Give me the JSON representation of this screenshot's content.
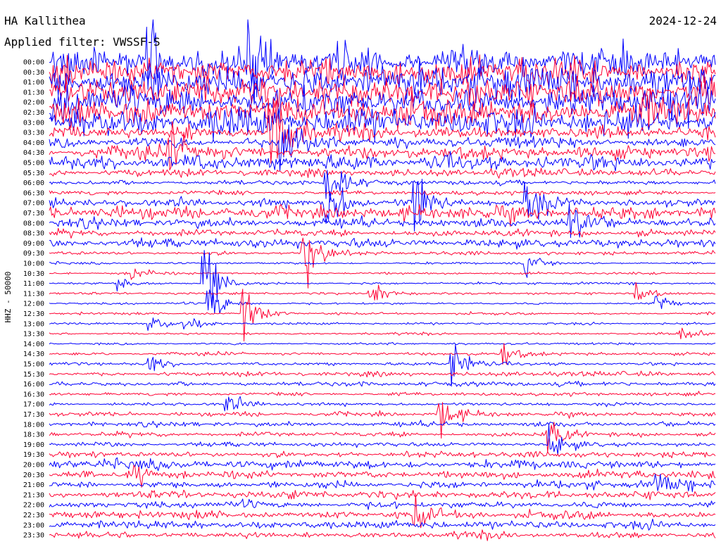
{
  "header": {
    "station": "HA Kallithea",
    "filter": "Applied filter: VWSSF-S",
    "date": "2024-12-24"
  },
  "chart_data": {
    "type": "line",
    "title": "HA Kallithea",
    "subtitle": "Applied filter: VWSSF-S",
    "date": "2024-12-24",
    "ylabel": "HHZ - 50000",
    "row_labels": [
      "00:00",
      "00:30",
      "01:00",
      "01:30",
      "02:00",
      "02:30",
      "03:00",
      "03:30",
      "04:00",
      "04:30",
      "05:00",
      "05:30",
      "06:00",
      "06:30",
      "07:00",
      "07:30",
      "08:00",
      "08:30",
      "09:00",
      "09:30",
      "10:00",
      "10:30",
      "11:00",
      "11:30",
      "12:00",
      "12:30",
      "13:00",
      "13:30",
      "14:00",
      "14:30",
      "15:00",
      "15:30",
      "16:00",
      "16:30",
      "17:00",
      "17:30",
      "18:00",
      "18:30",
      "19:00",
      "19:30",
      "20:00",
      "20:30",
      "21:00",
      "21:30",
      "22:00",
      "22:30",
      "23:00",
      "23:30"
    ],
    "series_colors": [
      "#0000ff",
      "#ff0033"
    ],
    "grid": false,
    "legend": "none",
    "x_range_minutes_per_row": [
      0,
      30
    ],
    "activity_level_by_row": [
      5,
      5,
      6,
      5,
      6,
      5,
      5,
      2.5,
      2,
      2,
      2.5,
      1.3,
      0.8,
      0.8,
      1.3,
      2.2,
      1.5,
      1.2,
      1.6,
      0.6,
      0.4,
      0.4,
      0.4,
      0.4,
      0.4,
      0.4,
      0.4,
      0.4,
      0.4,
      0.5,
      0.5,
      0.8,
      0.8,
      0.6,
      0.6,
      0.7,
      0.8,
      0.8,
      0.8,
      1.0,
      1.6,
      1.3,
      1.3,
      1.3,
      1.3,
      1.3,
      1.4,
      1.2
    ],
    "events": [
      {
        "row": 0,
        "minute": 9.0,
        "amplitude": 6
      },
      {
        "row": 0,
        "minute": 4.5,
        "amplitude": 5
      },
      {
        "row": 7,
        "minute": 10.0,
        "amplitude": 6
      },
      {
        "row": 8,
        "minute": 10.5,
        "amplitude": 4
      },
      {
        "row": 9,
        "minute": 5.5,
        "amplitude": 3
      },
      {
        "row": 12,
        "minute": 12.5,
        "amplitude": 4
      },
      {
        "row": 14,
        "minute": 12.5,
        "amplitude": 5
      },
      {
        "row": 14,
        "minute": 16.5,
        "amplitude": 4
      },
      {
        "row": 14,
        "minute": 21.5,
        "amplitude": 4
      },
      {
        "row": 16,
        "minute": 23.5,
        "amplitude": 3
      },
      {
        "row": 19,
        "minute": 11.5,
        "amplitude": 4
      },
      {
        "row": 20,
        "minute": 21.5,
        "amplitude": 1.3
      },
      {
        "row": 21,
        "minute": 3.8,
        "amplitude": 1
      },
      {
        "row": 22,
        "minute": 7.0,
        "amplitude": 5
      },
      {
        "row": 22,
        "minute": 3.2,
        "amplitude": 1
      },
      {
        "row": 23,
        "minute": 14.5,
        "amplitude": 1.6
      },
      {
        "row": 23,
        "minute": 26.5,
        "amplitude": 1
      },
      {
        "row": 24,
        "minute": 7.2,
        "amplitude": 2.5
      },
      {
        "row": 24,
        "minute": 27.4,
        "amplitude": 1.2
      },
      {
        "row": 25,
        "minute": 8.8,
        "amplitude": 3
      },
      {
        "row": 26,
        "minute": 4.5,
        "amplitude": 1.4
      },
      {
        "row": 26,
        "minute": 6.2,
        "amplitude": 1
      },
      {
        "row": 27,
        "minute": 28.5,
        "amplitude": 1.2
      },
      {
        "row": 29,
        "minute": 20.5,
        "amplitude": 1.3
      },
      {
        "row": 30,
        "minute": 4.5,
        "amplitude": 1.2
      },
      {
        "row": 30,
        "minute": 18.2,
        "amplitude": 3
      },
      {
        "row": 34,
        "minute": 8.0,
        "amplitude": 1.2
      },
      {
        "row": 35,
        "minute": 17.6,
        "amplitude": 2.5
      },
      {
        "row": 37,
        "minute": 22.5,
        "amplitude": 2
      },
      {
        "row": 38,
        "minute": 22.6,
        "amplitude": 2
      },
      {
        "row": 41,
        "minute": 3.8,
        "amplitude": 2
      },
      {
        "row": 42,
        "minute": 27.4,
        "amplitude": 1.3
      },
      {
        "row": 45,
        "minute": 16.5,
        "amplitude": 2
      }
    ]
  }
}
